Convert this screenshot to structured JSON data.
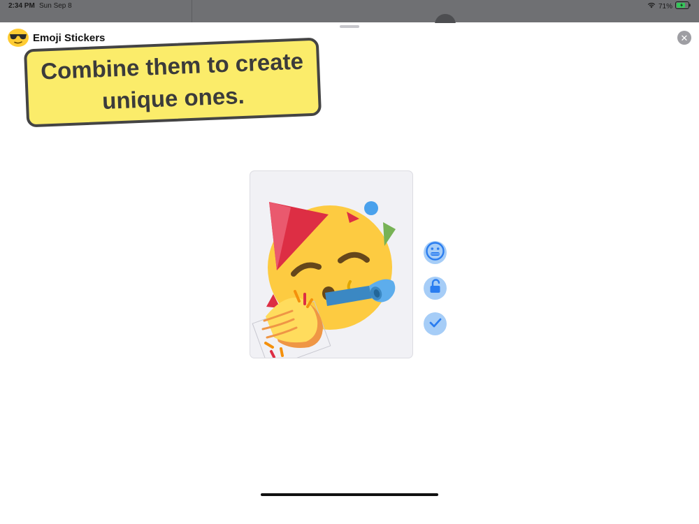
{
  "status_bar": {
    "time": "2:34 PM",
    "date": "Sun Sep 8",
    "battery": "71%",
    "icons": [
      "wifi-icon",
      "battery-icon"
    ]
  },
  "header": {
    "app_title": "Emoji Stickers",
    "app_icon": "sunglasses-emoji-icon",
    "close_icon": "close-icon",
    "close_glyph": "✕"
  },
  "banner": {
    "text": "Combine them to create unique ones."
  },
  "canvas": {
    "sticker": "party-face-with-clapping-hands",
    "layers": [
      "party-face-emoji",
      "clapping-hands-emoji"
    ]
  },
  "actions": [
    {
      "icon": "grimacing-face-icon"
    },
    {
      "icon": "unlock-icon"
    },
    {
      "icon": "checkmark-icon"
    }
  ],
  "colors": {
    "banner_fill": "#fbec6a",
    "banner_border": "#444444",
    "action_bg": "#a6cdf7",
    "action_fg": "#2a7df0"
  }
}
